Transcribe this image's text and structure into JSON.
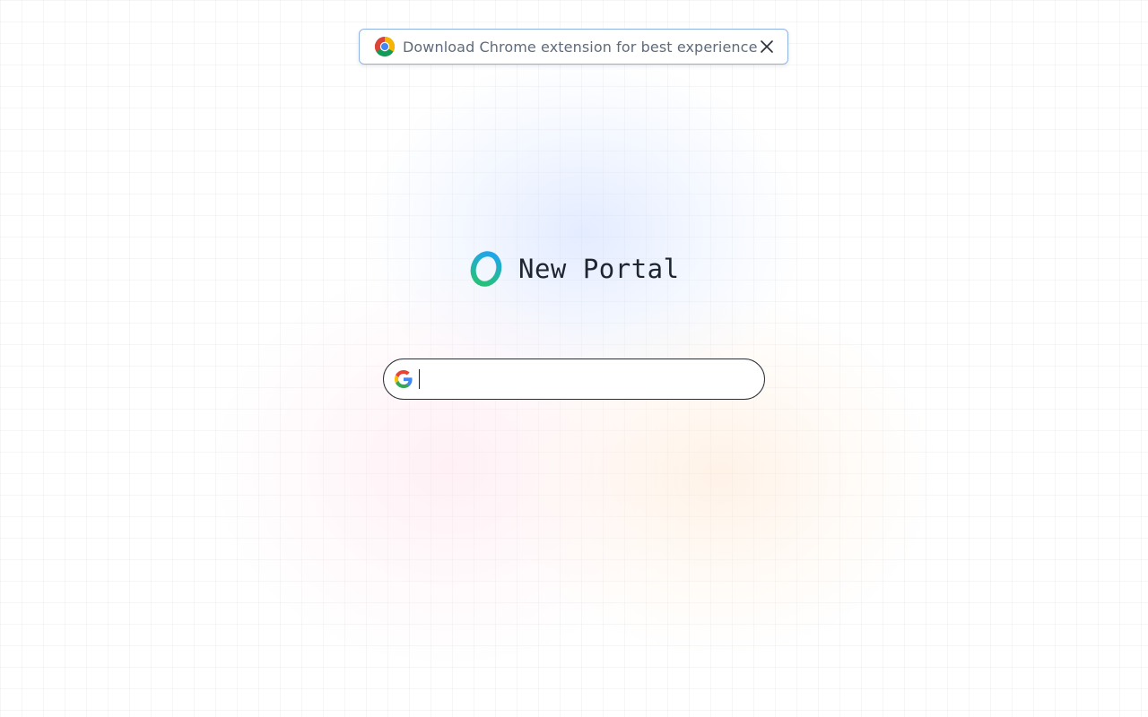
{
  "banner": {
    "text": "Download Chrome extension for best experience",
    "icon": "chrome-icon",
    "close_icon": "close-icon",
    "border_color": "#8fb4e6"
  },
  "brand": {
    "title": "New Portal",
    "logo_icon": "portal-logo-icon",
    "logo_colors": [
      "#1ea7e8",
      "#27c07a"
    ]
  },
  "search": {
    "value": "",
    "placeholder": "",
    "engine_icon": "google-icon"
  }
}
